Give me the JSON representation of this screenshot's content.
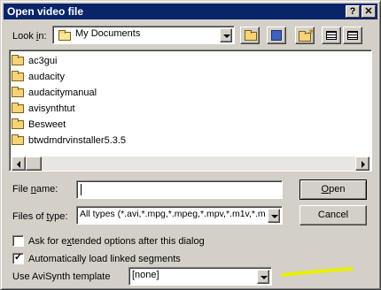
{
  "window": {
    "title": "Open video file",
    "help_btn": "?",
    "close_btn": "✕"
  },
  "lookin": {
    "label": "Look in:",
    "value": "My Documents"
  },
  "files": [
    {
      "name": "ac3gui"
    },
    {
      "name": "audacity"
    },
    {
      "name": "audacitymanual"
    },
    {
      "name": "avisynthtut"
    },
    {
      "name": "Besweet"
    },
    {
      "name": "btwdmdrvinstaller5.3.5"
    }
  ],
  "filename": {
    "label": "File name:",
    "value": ""
  },
  "filetype": {
    "label": "Files of type:",
    "value": "All types (*.avi,*.mpg,*.mpeg,*.mpv,*.m1v,*.m"
  },
  "buttons": {
    "open": "Open",
    "cancel": "Cancel"
  },
  "options": {
    "extended": {
      "label": "Ask for extended options after this dialog",
      "checked": false
    },
    "linked": {
      "label": "Automatically load linked segments",
      "checked": true
    }
  },
  "avisynth": {
    "label": "Use AviSynth template",
    "value": "[none]"
  },
  "colors": {
    "titlebar": "#0a246a",
    "face": "#d4d0c8",
    "highlight": "#e8f000"
  }
}
